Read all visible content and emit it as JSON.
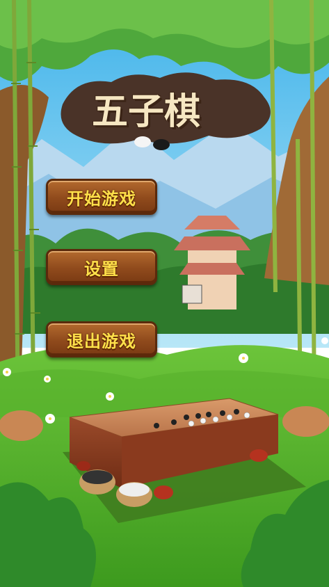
{
  "game": {
    "title": "五子棋"
  },
  "menu": {
    "start_label": "开始游戏",
    "settings_label": "设置",
    "exit_label": "退出游戏"
  },
  "colors": {
    "button_text": "#ffe04a",
    "button_wood": "#8f4a1c",
    "sky": "#63c4f0",
    "grass": "#4fb52a"
  }
}
